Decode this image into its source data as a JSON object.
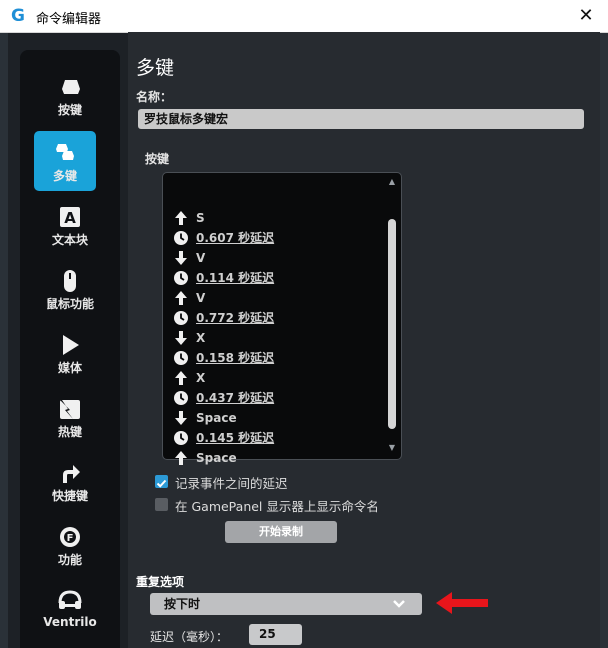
{
  "window": {
    "title": "命令编辑器"
  },
  "sidebar": {
    "items": [
      {
        "label": "按键",
        "icon": "keycap-icon"
      },
      {
        "label": "多键",
        "icon": "multikey-icon",
        "active": true
      },
      {
        "label": "文本块",
        "icon": "text-block-icon"
      },
      {
        "label": "鼠标功能",
        "icon": "mouse-icon"
      },
      {
        "label": "媒体",
        "icon": "play-icon"
      },
      {
        "label": "热键",
        "icon": "hotkey-icon"
      },
      {
        "label": "快捷键",
        "icon": "shortcut-arrow-icon"
      },
      {
        "label": "功能",
        "icon": "function-icon"
      },
      {
        "label": "Ventrilo",
        "icon": "headset-icon"
      }
    ]
  },
  "main": {
    "heading": "多键",
    "name_label": "名称：",
    "name_value": "罗技鼠标多键宏",
    "keys_label": "按键",
    "events": [
      {
        "type": "up",
        "text": "S"
      },
      {
        "type": "delay",
        "text": "0.607 秒延迟"
      },
      {
        "type": "down",
        "text": "V"
      },
      {
        "type": "delay",
        "text": "0.114 秒延迟"
      },
      {
        "type": "up",
        "text": "V"
      },
      {
        "type": "delay",
        "text": "0.772 秒延迟"
      },
      {
        "type": "down",
        "text": "X"
      },
      {
        "type": "delay",
        "text": "0.158 秒延迟"
      },
      {
        "type": "up",
        "text": "X"
      },
      {
        "type": "delay",
        "text": "0.437 秒延迟"
      },
      {
        "type": "down",
        "text": "Space"
      },
      {
        "type": "delay",
        "text": "0.145 秒延迟"
      },
      {
        "type": "up",
        "text": "Space"
      }
    ],
    "record_delays_label": "记录事件之间的延迟",
    "record_delays_checked": true,
    "show_name_label": "在 GamePanel 显示器上显示命令名",
    "show_name_checked": false,
    "record_button": "开始录制",
    "repeat_label": "重复选项",
    "repeat_value": "按下时",
    "delay_label": "延迟（毫秒）：",
    "delay_value": "25"
  },
  "colors": {
    "accent": "#1aa3d9",
    "annotation_arrow": "#e8151b"
  }
}
